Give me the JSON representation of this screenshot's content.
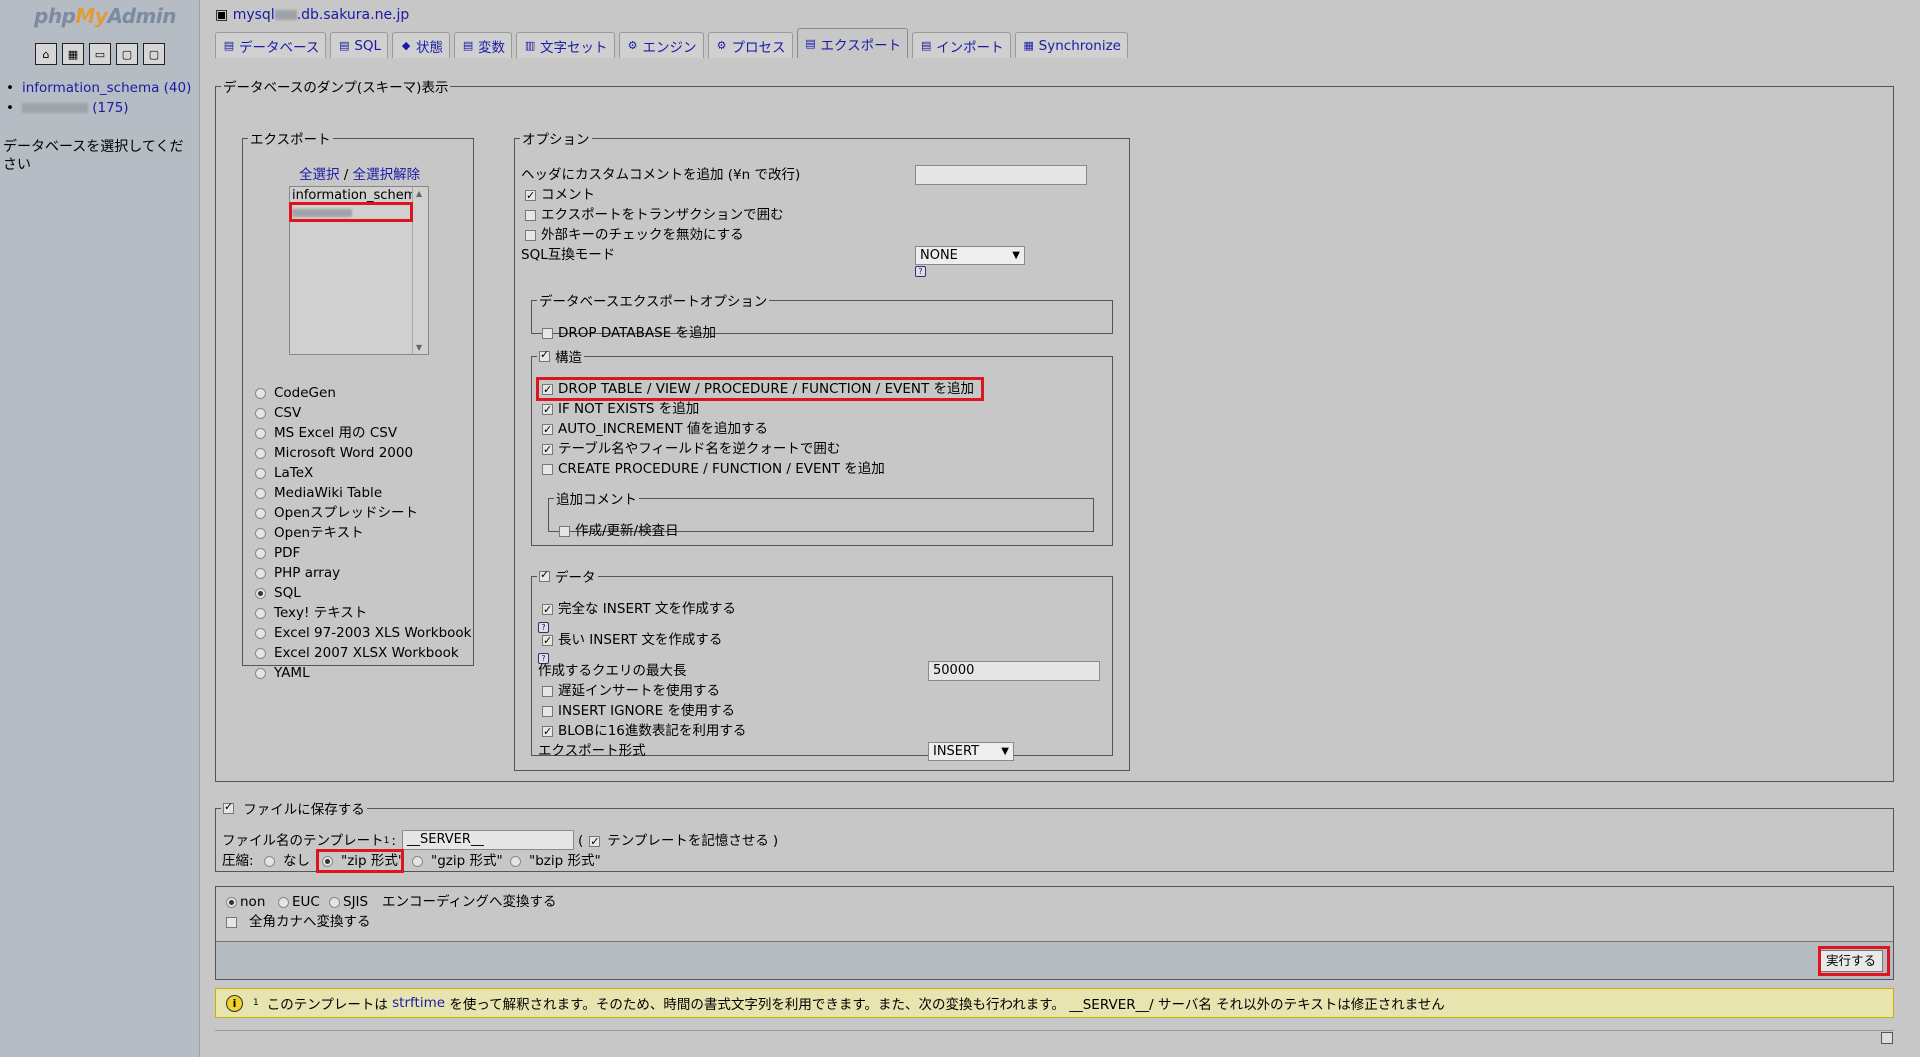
{
  "left": {
    "logo_php": "php",
    "logo_my": "My",
    "logo_admin": "Admin",
    "icons": [
      "home-icon",
      "query-window-icon",
      "sql-docs-icon",
      "docs-icon",
      "reload-icon"
    ],
    "databases": [
      {
        "label": "information_schema (40)"
      },
      {
        "label": "(175)"
      }
    ],
    "message": "データベースを選択してください"
  },
  "server": {
    "title_prefix": "mysql",
    "title_suffix": ".db.sakura.ne.jp"
  },
  "tabs": [
    {
      "label": "データベース",
      "icon": "database-icon"
    },
    {
      "label": "SQL",
      "icon": "sql-icon"
    },
    {
      "label": "状態",
      "icon": "status-icon"
    },
    {
      "label": "変数",
      "icon": "variables-icon"
    },
    {
      "label": "文字セット",
      "icon": "charset-icon"
    },
    {
      "label": "エンジン",
      "icon": "engine-icon"
    },
    {
      "label": "プロセス",
      "icon": "process-icon"
    },
    {
      "label": "エクスポート",
      "icon": "export-icon",
      "active": true
    },
    {
      "label": "インポート",
      "icon": "import-icon"
    },
    {
      "label": "Synchronize",
      "icon": "sync-icon"
    }
  ],
  "dump": {
    "legend": "データベースのダンプ(スキーマ)表示",
    "export": {
      "legend": "エクスポート",
      "select_all": "全選択",
      "separator": "/",
      "deselect_all": "全選択解除",
      "db_options": [
        "information_schema",
        ""
      ],
      "formats": [
        "CodeGen",
        "CSV",
        "MS Excel 用の CSV",
        "Microsoft Word 2000",
        "LaTeX",
        "MediaWiki Table",
        "Openスプレッドシート",
        "Openテキスト",
        "PDF",
        "PHP array",
        "SQL",
        "Texy! テキスト",
        "Excel 97-2003 XLS Workbook",
        "Excel 2007 XLSX Workbook",
        "YAML"
      ],
      "selected_format": "SQL"
    },
    "options": {
      "legend": "オプション",
      "header_comment_label": "ヘッダにカスタムコメントを追加 (¥n で改行)",
      "header_comment_value": "",
      "comment": "コメント",
      "transaction": "エクスポートをトランザクションで囲む",
      "foreign_key": "外部キーのチェックを無効にする",
      "sql_compat_label": "SQL互換モード",
      "sql_compat_value": "NONE",
      "db_export_legend": "データベースエクスポートオプション",
      "drop_database": "DROP DATABASE を追加",
      "structure": {
        "legend": "構造",
        "drop_table": "DROP TABLE / VIEW / PROCEDURE / FUNCTION / EVENT を追加",
        "if_not_exists": "IF NOT EXISTS を追加",
        "auto_increment": "AUTO_INCREMENT 値を追加する",
        "backquotes": "テーブル名やフィールド名を逆クォートで囲む",
        "create_procedure": "CREATE PROCEDURE / FUNCTION / EVENT を追加",
        "add_comment_legend": "追加コメント",
        "dates": "作成/更新/検査日"
      },
      "data": {
        "legend": "データ",
        "complete_insert": "完全な INSERT 文を作成する",
        "extended_insert": "長い INSERT 文を作成する",
        "max_query_label": "作成するクエリの最大長",
        "max_query_value": "50000",
        "delayed_insert": "遅延インサートを使用する",
        "insert_ignore": "INSERT IGNORE を使用する",
        "hex_blob": "BLOBに16進数表記を利用する",
        "export_type_label": "エクスポート形式",
        "export_type_value": "INSERT"
      }
    }
  },
  "save": {
    "legend": "ファイルに保存する",
    "template_label": "ファイル名のテンプレート",
    "template_sup": "1",
    "template_colon": ":",
    "template_value": "__SERVER__",
    "paren_open": "(",
    "remember": "テンプレートを記憶させる",
    "paren_close": ")",
    "compression_label": "圧縮:",
    "none": "なし",
    "zip": "\"zip 形式\"",
    "gzip": "\"gzip 形式\"",
    "bzip": "\"bzip 形式\""
  },
  "encoding": {
    "non": "non",
    "euc": "EUC",
    "sjis": "SJIS",
    "convert_label": "エンコーディングへ変換する",
    "kana": "全角カナへ変換する"
  },
  "go_button": "実行する",
  "footnote": {
    "sup": "1",
    "text_before": "このテンプレートは",
    "link": "strftime",
    "text_after": "を使って解釈されます。そのため、時間の書式文字列を利用できます。また、次の変換も行われます。 __SERVER__/ サーバ名 それ以外のテキストは修正されません"
  },
  "colors": {
    "highlight": "#e0141e",
    "note_bg": "#e8e4b0",
    "link": "#1a1aa6"
  }
}
